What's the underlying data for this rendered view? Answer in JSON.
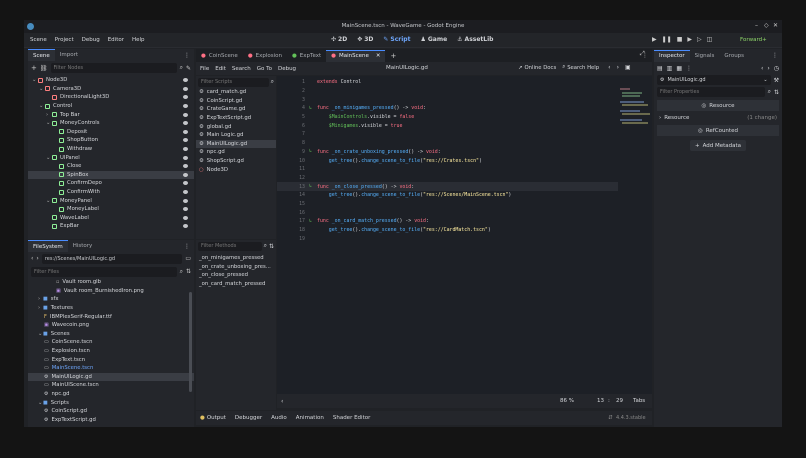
{
  "window": {
    "title": "MainScene.tscn - WaveGame - Godot Engine"
  },
  "menu": [
    "Scene",
    "Project",
    "Debug",
    "Editor",
    "Help"
  ],
  "workspaces": [
    {
      "label": "2D",
      "icon": "2d-icon"
    },
    {
      "label": "3D",
      "icon": "3d-icon"
    },
    {
      "label": "Script",
      "icon": "script-icon",
      "active": true
    },
    {
      "label": "Game",
      "icon": "game-icon"
    },
    {
      "label": "AssetLib",
      "icon": "assetlib-icon"
    }
  ],
  "renderer": "Forward+",
  "scene_dock": {
    "tabs": [
      "Scene",
      "Import"
    ],
    "filter_placeholder": "Filter Nodes",
    "nodes": [
      {
        "name": "Node3D",
        "color": "#fc7f7f"
      },
      {
        "name": "Camera3D",
        "color": "#fc7f7f"
      },
      {
        "name": "DirectionalLight3D",
        "color": "#fc7f7f"
      },
      {
        "name": "Control",
        "color": "#8eef97"
      },
      {
        "name": "Top Bar",
        "color": "#8eef97"
      },
      {
        "name": "MoneyControls",
        "color": "#8eef97"
      },
      {
        "name": "Deposit",
        "color": "#8eef97"
      },
      {
        "name": "ShopButton",
        "color": "#8eef97"
      },
      {
        "name": "Withdraw",
        "color": "#8eef97"
      },
      {
        "name": "UIPanel",
        "color": "#8eef97"
      },
      {
        "name": "Close",
        "color": "#8eef97"
      },
      {
        "name": "SpinBox",
        "color": "#8eef97",
        "selected": true
      },
      {
        "name": "ConfirmDepo",
        "color": "#8eef97"
      },
      {
        "name": "ConfirmWith",
        "color": "#8eef97"
      },
      {
        "name": "MoneyPanel",
        "color": "#8eef97"
      },
      {
        "name": "MoneyLabel",
        "color": "#8eef97"
      },
      {
        "name": "WaveLabel",
        "color": "#8eef97"
      },
      {
        "name": "ExpBar",
        "color": "#8eef97"
      }
    ]
  },
  "filesystem": {
    "tabs": [
      "FileSystem",
      "History"
    ],
    "path": "res://Scenes/MainUILogic.gd",
    "filter_placeholder": "Filter Files",
    "items": [
      {
        "name": "Vault room.glb",
        "icon": "file-icon"
      },
      {
        "name": "Vault room_BurnishedIron.png",
        "icon": "image-icon"
      },
      {
        "name": "sfx",
        "icon": "folder-icon"
      },
      {
        "name": "Textures",
        "icon": "folder-icon"
      },
      {
        "name": "IBMPlexSerif-Regular.ttf",
        "icon": "font-icon"
      },
      {
        "name": "Wavecoin.png",
        "icon": "image-icon"
      },
      {
        "name": "Scenes",
        "icon": "folder-icon"
      },
      {
        "name": "CoinScene.tscn",
        "icon": "scene-icon"
      },
      {
        "name": "Explosion.tscn",
        "icon": "scene-icon"
      },
      {
        "name": "ExpText.tscn",
        "icon": "scene-icon"
      },
      {
        "name": "MainScene.tscn",
        "icon": "scene-icon",
        "highlight": true
      },
      {
        "name": "MainUILogic.gd",
        "icon": "gear-icon",
        "selected": true
      },
      {
        "name": "MainUIScene.tscn",
        "icon": "scene-icon"
      },
      {
        "name": "npc.gd",
        "icon": "gear-icon"
      },
      {
        "name": "Scripts",
        "icon": "folder-icon"
      },
      {
        "name": "CoinScript.gd",
        "icon": "gear-icon"
      },
      {
        "name": "ExpTextScript.gd",
        "icon": "gear-icon"
      }
    ]
  },
  "editor_tabs": [
    {
      "label": "CoinScene",
      "color": "#ff7085"
    },
    {
      "label": "Explosion",
      "color": "#ff7085"
    },
    {
      "label": "ExpText",
      "color": "#63c259"
    },
    {
      "label": "MainScene",
      "color": "#ff7085",
      "active": true
    }
  ],
  "script_menu": [
    "File",
    "Edit",
    "Search",
    "Go To",
    "Debug"
  ],
  "current_file": "MainUILogic.gd",
  "online_docs": "Online Docs",
  "search_help": "Search Help",
  "scripts_filter_placeholder": "Filter Scripts",
  "scripts": [
    {
      "name": "card_match.gd"
    },
    {
      "name": "CoinScript.gd"
    },
    {
      "name": "CrateGame.gd"
    },
    {
      "name": "ExpTextScript.gd"
    },
    {
      "name": "global.gd"
    },
    {
      "name": "Main Logic.gd"
    },
    {
      "name": "MainUILogic.gd",
      "selected": true
    },
    {
      "name": "npc.gd"
    },
    {
      "name": "ShopScript.gd"
    },
    {
      "name": "Node3D"
    }
  ],
  "methods_filter_placeholder": "Filter Methods",
  "methods": [
    "_on_minigames_pressed",
    "_on_crate_unboxing_pres...",
    "_on_close_pressed",
    "_on_card_match_pressed"
  ],
  "code": [
    {
      "n": "1",
      "segs": [
        [
          "kw",
          "extends "
        ],
        [
          "pl",
          "Control"
        ]
      ]
    },
    {
      "n": "2",
      "segs": []
    },
    {
      "n": "3",
      "segs": []
    },
    {
      "n": "4",
      "mark": true,
      "segs": [
        [
          "kw",
          "func "
        ],
        [
          "fn",
          "_on_minigames_pressed"
        ],
        [
          "pl",
          "() -> "
        ],
        [
          "kw",
          "void"
        ],
        [
          "pl",
          ":"
        ]
      ]
    },
    {
      "n": "5",
      "segs": [
        [
          "pl",
          "    "
        ],
        [
          "node",
          "$MainControls"
        ],
        [
          "pl",
          ".visible = "
        ],
        [
          "bool",
          "false"
        ]
      ]
    },
    {
      "n": "6",
      "segs": [
        [
          "pl",
          "    "
        ],
        [
          "node",
          "$Minigames"
        ],
        [
          "pl",
          ".visible = "
        ],
        [
          "bool",
          "true"
        ]
      ]
    },
    {
      "n": "7",
      "segs": []
    },
    {
      "n": "8",
      "segs": []
    },
    {
      "n": "9",
      "mark": true,
      "segs": [
        [
          "kw",
          "func "
        ],
        [
          "fn",
          "_on_crate_unboxing_pressed"
        ],
        [
          "pl",
          "() -> "
        ],
        [
          "kw",
          "void"
        ],
        [
          "pl",
          ":"
        ]
      ]
    },
    {
      "n": "10",
      "segs": [
        [
          "pl",
          "    "
        ],
        [
          "fn",
          "get_tree"
        ],
        [
          "pl",
          "()."
        ],
        [
          "fn",
          "change_scene_to_file"
        ],
        [
          "pl",
          "("
        ],
        [
          "str",
          "\"res://Crates.tscn\""
        ],
        [
          "pl",
          ")"
        ]
      ]
    },
    {
      "n": "11",
      "segs": []
    },
    {
      "n": "12",
      "segs": []
    },
    {
      "n": "13",
      "mark": true,
      "cur": true,
      "segs": [
        [
          "kw",
          "func "
        ],
        [
          "fn",
          "_on_close_pressed"
        ],
        [
          "pl",
          "() -> "
        ],
        [
          "kw",
          "void"
        ],
        [
          "pl",
          ":"
        ]
      ]
    },
    {
      "n": "14",
      "segs": [
        [
          "pl",
          "    "
        ],
        [
          "fn",
          "get_tree"
        ],
        [
          "pl",
          "()."
        ],
        [
          "fn",
          "change_scene_to_file"
        ],
        [
          "pl",
          "("
        ],
        [
          "str",
          "\"res://Scenes/MainScene.tscn\""
        ],
        [
          "pl",
          ")"
        ]
      ]
    },
    {
      "n": "15",
      "segs": []
    },
    {
      "n": "16",
      "segs": []
    },
    {
      "n": "17",
      "mark": true,
      "segs": [
        [
          "kw",
          "func "
        ],
        [
          "fn",
          "_on_card_match_pressed"
        ],
        [
          "pl",
          "() -> "
        ],
        [
          "kw",
          "void"
        ],
        [
          "pl",
          ":"
        ]
      ]
    },
    {
      "n": "18",
      "segs": [
        [
          "pl",
          "    "
        ],
        [
          "fn",
          "get_tree"
        ],
        [
          "pl",
          "()."
        ],
        [
          "fn",
          "change_scene_to_file"
        ],
        [
          "pl",
          "("
        ],
        [
          "str",
          "\"res://CardMatch.tscn\""
        ],
        [
          "pl",
          ")"
        ]
      ]
    },
    {
      "n": "19",
      "segs": []
    }
  ],
  "status": {
    "zoom": "86 %",
    "line": "13",
    "col": "29",
    "indent": "Tabs"
  },
  "bottom_tabs": [
    "Output",
    "Debugger",
    "Audio",
    "Animation",
    "Shader Editor"
  ],
  "version": "4.4.3.stable",
  "inspector": {
    "tabs": [
      "Inspector",
      "Signals",
      "Groups"
    ],
    "object": "MainUILogic.gd",
    "filter_placeholder": "Filter Properties",
    "section": "Resource",
    "group": "Resource",
    "group_change": "(1 change)",
    "refcounted": "RefCounted",
    "add_metadata": "Add Metadata"
  }
}
